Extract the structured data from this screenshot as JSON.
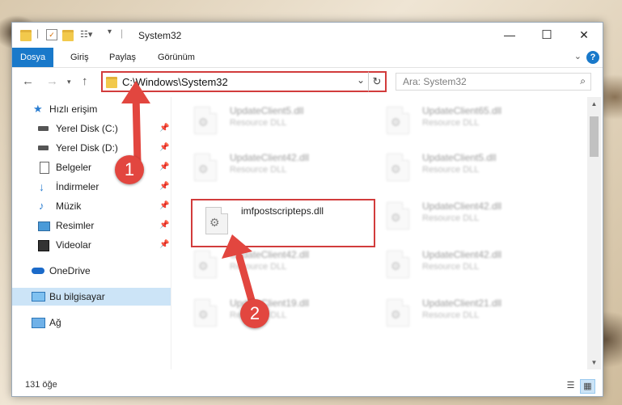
{
  "window": {
    "title": "System32",
    "controls": {
      "minimize": "—",
      "maximize": "☐",
      "close": "✕"
    }
  },
  "ribbon": {
    "tabs": [
      {
        "label": "Dosya",
        "active": true
      },
      {
        "label": "Giriş"
      },
      {
        "label": "Paylaş"
      },
      {
        "label": "Görünüm"
      }
    ],
    "help_label": "?"
  },
  "address": {
    "path": "C:\\Windows\\System32",
    "search_placeholder": "Ara: System32"
  },
  "nav": {
    "quick_access": "Hızlı erişim",
    "items": [
      {
        "label": "Yerel Disk (C:)",
        "icon": "drive-icon"
      },
      {
        "label": "Yerel Disk (D:)",
        "icon": "drive-icon"
      },
      {
        "label": "Belgeler",
        "icon": "documents-icon"
      },
      {
        "label": "İndirmeler",
        "icon": "downloads-icon"
      },
      {
        "label": "Müzik",
        "icon": "music-icon"
      },
      {
        "label": "Resimler",
        "icon": "pictures-icon"
      },
      {
        "label": "Videolar",
        "icon": "videos-icon"
      }
    ],
    "onedrive": "OneDrive",
    "this_pc": "Bu bilgisayar",
    "network": "Ağ"
  },
  "files": [
    {
      "name": "UpdateClient5.dll",
      "type": "Resource DLL"
    },
    {
      "name": "UpdateClient65.dll",
      "type": "Resource DLL"
    },
    {
      "name": "UpdateClient42.dll",
      "type": "Resource DLL"
    },
    {
      "name": "UpdateClient5.dll",
      "type": "Resource DLL"
    },
    {
      "name": "imfpostscripteps.dll",
      "type": ""
    },
    {
      "name": "UpdateClient42.dll",
      "type": "Resource DLL"
    },
    {
      "name": "UpdateClient42.dll",
      "type": "Resource DLL"
    },
    {
      "name": "UpdateClient42.dll",
      "type": "Resource DLL"
    },
    {
      "name": "UpdateClient19.dll",
      "type": "Resource DLL"
    },
    {
      "name": "UpdateClient21.dll",
      "type": "Resource DLL"
    }
  ],
  "status": {
    "count": "131 öğe"
  },
  "annotations": {
    "step1": "1",
    "step2": "2",
    "color": "#e2463f"
  }
}
